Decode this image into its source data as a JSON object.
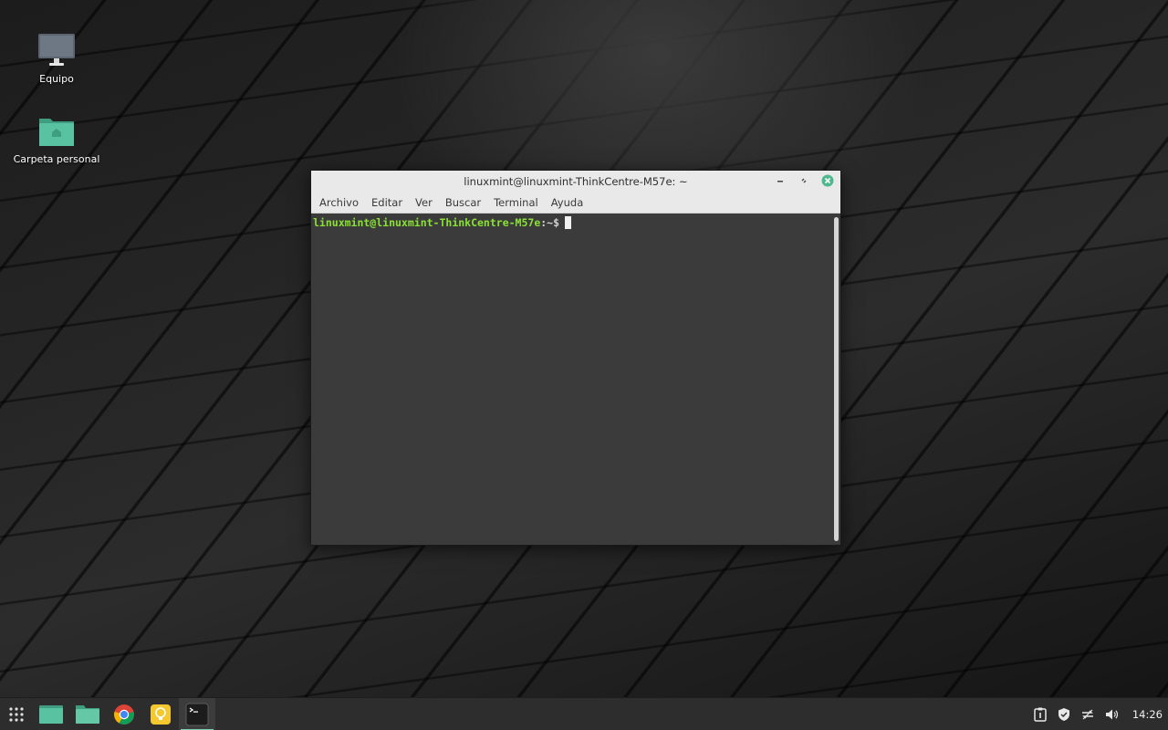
{
  "desktop": {
    "icons": [
      {
        "label": "Equipo",
        "icon": "computer-icon"
      },
      {
        "label": "Carpeta personal",
        "icon": "home-folder-icon"
      }
    ]
  },
  "window": {
    "title": "linuxmint@linuxmint-ThinkCentre-M57e: ~",
    "menu": [
      "Archivo",
      "Editar",
      "Ver",
      "Buscar",
      "Terminal",
      "Ayuda"
    ],
    "prompt_user": "linuxmint@linuxmint-ThinkCentre-M57e",
    "prompt_path": ":~$",
    "close_color": "#4fb88e"
  },
  "taskbar": {
    "apps": [
      "menu-grid-icon",
      "file-manager-icon",
      "folder-icon",
      "chrome-icon",
      "lightbulb-icon",
      "terminal-icon"
    ],
    "tray": [
      "clipboard-icon",
      "shield-icon",
      "network-icon",
      "volume-icon"
    ],
    "clock": "14:26",
    "accent": "#7ed0b0"
  }
}
